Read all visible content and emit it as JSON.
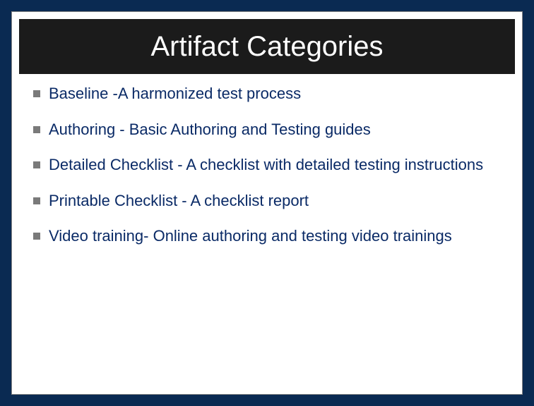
{
  "slide": {
    "title": "Artifact Categories",
    "bullets": [
      "Baseline -A harmonized test process",
      "Authoring - Basic Authoring and Testing guides",
      "Detailed Checklist - A checklist with detailed testing instructions",
      "Printable Checklist - A checklist report",
      "Video training- Online authoring and testing video trainings"
    ]
  }
}
